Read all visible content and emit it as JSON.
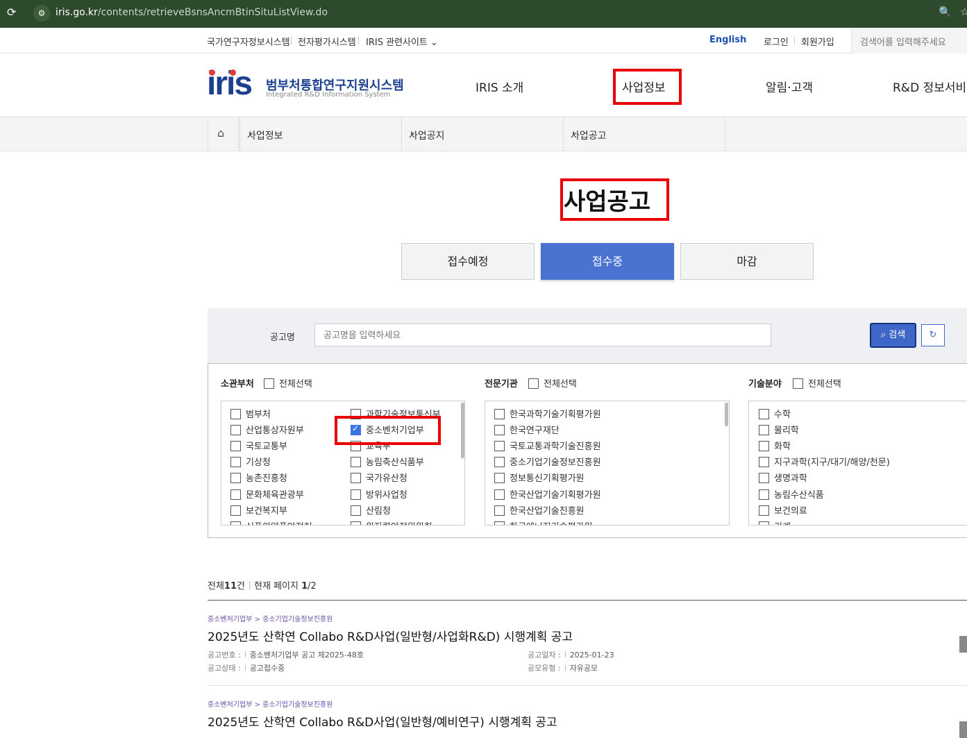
{
  "browser": {
    "url_host": "iris.go.kr",
    "url_path": "/contents/retrieveBsnsAncmBtinSituListView.do"
  },
  "util": {
    "links": [
      "국가연구자정보시스템",
      "전자평가시스템",
      "IRIS 관련사이트"
    ],
    "english": "English",
    "login": "로그인",
    "join": "회원가입",
    "search_placeholder": "검색어를 입력해주세요"
  },
  "header": {
    "logo_text": "iris",
    "logo_ko": "범부처통합연구지원시스템",
    "logo_en": "Integrated R&D Information System",
    "gnb": [
      "IRIS 소개",
      "사업정보",
      "알림·고객",
      "R&D 정보서비스"
    ]
  },
  "subnav": {
    "items": [
      "사업정보",
      "사업공지",
      "사업공고"
    ]
  },
  "page": {
    "title": "사업공고",
    "tabs": [
      "접수예정",
      "접수중",
      "마감"
    ],
    "active_tab": "접수중"
  },
  "search": {
    "label": "공고명",
    "placeholder": "공고명을 입력하세요",
    "button": "검색"
  },
  "filters": {
    "ministry": {
      "title": "소관부처",
      "select_all": "전체선택",
      "col1": [
        "범부처",
        "산업통상자원부",
        "국토교통부",
        "기상청",
        "농촌진흥청",
        "문화체육관광부",
        "보건복지부",
        "식품의약품안전처"
      ],
      "col2": [
        "과학기술정보통신부",
        "중소벤처기업부",
        "교육부",
        "농림축산식품부",
        "국가유산청",
        "방위사업청",
        "산림청",
        "원자력안전위원회"
      ],
      "checked": "중소벤처기업부"
    },
    "agency": {
      "title": "전문기관",
      "select_all": "전체선택",
      "items": [
        "한국과학기술기획평가원",
        "한국연구재단",
        "국토교통과학기술진흥원",
        "중소기업기술정보진흥원",
        "정보통신기획평가원",
        "한국산업기술기획평가원",
        "한국산업기술진흥원",
        "한국에너지기술평가원"
      ]
    },
    "tech": {
      "title": "기술분야",
      "select_all": "전체선택",
      "items": [
        "수학",
        "물리학",
        "화학",
        "지구과학(지구/대기/해양/천문)",
        "생명과학",
        "농림수산식품",
        "보건의료",
        "기계"
      ]
    }
  },
  "results": {
    "total_prefix": "전체",
    "total": "11",
    "total_suffix": "건",
    "page_prefix": "현재 페이지",
    "page_current": "1",
    "page_total": "/2",
    "items": [
      {
        "category": "중소벤처기업부 > 중소기업기술정보진흥원",
        "title": "2025년도 산학연 Collabo R&D사업(일반형/사업화R&D) 시행계획 공고",
        "no_label": "공고번호 :",
        "no": "중소벤처기업부 공고 제2025-48호",
        "date_label": "공고일자 :",
        "date": "2025-01-23",
        "status_label": "공고상태 :",
        "status": "공고접수중",
        "type_label": "공모유형 :",
        "type": "자유공모"
      },
      {
        "category": "중소벤처기업부 > 중소기업기술정보진흥원",
        "title": "2025년도 산학연 Collabo R&D사업(일반형/예비연구) 시행계획 공고"
      }
    ]
  }
}
